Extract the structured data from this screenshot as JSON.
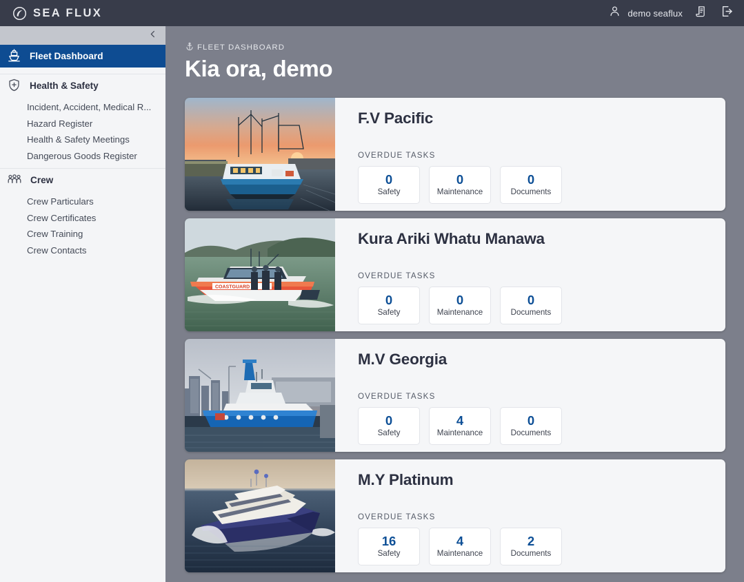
{
  "topbar": {
    "brand": "SEA FLUX",
    "brand_icon": "wave-circle-logo-icon",
    "user_name": "demo seaflux",
    "user_icon": "user-icon",
    "reports_icon": "document-report-icon",
    "logout_icon": "logout-icon"
  },
  "sidebar": {
    "collapse_icon": "chevron-left-icon",
    "groups": [
      {
        "icon": "ship-icon",
        "label": "Fleet Dashboard",
        "active": true,
        "items": []
      },
      {
        "icon": "shield-health-icon",
        "label": "Health & Safety",
        "active": false,
        "items": [
          "Incident, Accident, Medical R...",
          "Hazard Register",
          "Health & Safety Meetings",
          "Dangerous Goods Register"
        ]
      },
      {
        "icon": "crew-people-icon",
        "label": "Crew",
        "active": false,
        "items": [
          "Crew Particulars",
          "Crew Certificates",
          "Crew Training",
          "Crew Contacts"
        ]
      }
    ]
  },
  "main": {
    "breadcrumb_icon": "anchor-icon",
    "breadcrumb": "FLEET DASHBOARD",
    "title": "Kia ora, demo",
    "overdue_label": "OVERDUE TASKS",
    "stat_labels": [
      "Safety",
      "Maintenance",
      "Documents"
    ],
    "vessels": [
      {
        "name": "F.V Pacific",
        "photo": "fishing-trawler-sunset-photo",
        "stats": {
          "safety": "0",
          "maintenance": "0",
          "documents": "0"
        }
      },
      {
        "name": "Kura Ariki Whatu Manawa",
        "photo": "coastguard-rescue-boat-photo",
        "stats": {
          "safety": "0",
          "maintenance": "0",
          "documents": "0"
        }
      },
      {
        "name": "M.V Georgia",
        "photo": "blue-tugboat-harbour-photo",
        "stats": {
          "safety": "0",
          "maintenance": "4",
          "documents": "0"
        }
      },
      {
        "name": "M.Y Platinum",
        "photo": "navy-superyacht-sea-photo",
        "stats": {
          "safety": "16",
          "maintenance": "4",
          "documents": "2"
        }
      }
    ]
  },
  "colors": {
    "topbar": "#383c4a",
    "sidebar": "#f4f5f7",
    "active_nav": "#0e4c92",
    "page_bg": "#7c7f8b",
    "card_bg": "#f5f6f8",
    "stat_number": "#0d4f96"
  }
}
